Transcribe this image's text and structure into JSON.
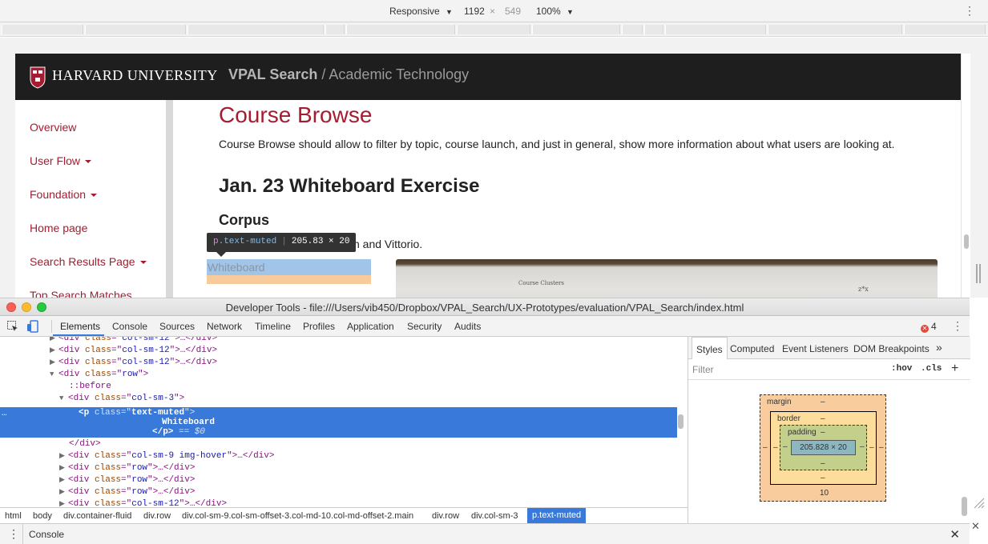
{
  "device_toolbar": {
    "mode": "Responsive",
    "width": "1192",
    "times": "×",
    "height": "549",
    "zoom": "100%",
    "more": "⋮"
  },
  "page": {
    "university": "HARVARD UNIVERSITY",
    "site_title": "VPAL Search",
    "site_subtitle": " / Academic Technology",
    "shield_text": "VE RI TAS",
    "nav": [
      {
        "label": "Overview",
        "dropdown": false
      },
      {
        "label": "User Flow",
        "dropdown": true
      },
      {
        "label": "Foundation",
        "dropdown": true
      },
      {
        "label": "Home page",
        "dropdown": false
      },
      {
        "label": "Search Results Page",
        "dropdown": true
      },
      {
        "label": "Top Search Matches",
        "dropdown": false
      }
    ],
    "heading": "Course Browse",
    "intro": "Course Browse should allow to filter by topic, course launch, and just in general, show more information about what users are looking at.",
    "exercise_heading": "Jan. 23 Whiteboard Exercise",
    "corpus_heading": "Corpus",
    "corpus_text_visible": "h and Vittorio.",
    "selected_text": "Whiteboard",
    "whiteboard_note_1": "Course\nClusters",
    "whiteboard_note_2": "z*x"
  },
  "tooltip": {
    "tag": "p",
    "cls": ".text-muted",
    "size": "205.83 × 20"
  },
  "devtools": {
    "title": "Developer Tools - file:///Users/vib450/Dropbox/VPAL_Search/UX-Prototypes/evaluation/VPAL_Search/index.html",
    "tabs": [
      "Elements",
      "Console",
      "Sources",
      "Network",
      "Timeline",
      "Profiles",
      "Application",
      "Security",
      "Audits"
    ],
    "active_tab": "Elements",
    "error_count": "4",
    "more": "⋮",
    "dom": {
      "l1": {
        "open": "<div ",
        "attr": "class",
        "eq": "=\"",
        "val": "col-sm-12",
        "close": "\">…</div>"
      },
      "l2": {
        "open": "<div ",
        "attr": "class",
        "eq": "=\"",
        "val": "col-sm-12",
        "close": "\">…</div>"
      },
      "l3": {
        "open": "<div ",
        "attr": "class",
        "eq": "=\"",
        "val": "col-sm-12",
        "close": "\">…</div>"
      },
      "l4": {
        "open": "<div ",
        "attr": "class",
        "eq": "=\"",
        "val": "row",
        "close": "\">"
      },
      "l5": "::before",
      "l6": {
        "open": "<div ",
        "attr": "class",
        "eq": "=\"",
        "val": "col-sm-3",
        "close": "\">"
      },
      "sel_open": "<p ",
      "sel_attr": "class",
      "sel_eq": "=\"",
      "sel_val": "text-muted",
      "sel_close": "\">",
      "sel_text": "Whiteboard",
      "sel_end": "</p>",
      "sel_marker": " == $0",
      "l8": "</div>",
      "l9": {
        "open": "<div ",
        "attr": "class",
        "eq": "=\"",
        "val": "col-sm-9 img-hover",
        "close": "\">…</div>"
      },
      "l10": {
        "open": "<div ",
        "attr": "class",
        "eq": "=\"",
        "val": "row",
        "close": "\">…</div>"
      },
      "l11": {
        "open": "<div ",
        "attr": "class",
        "eq": "=\"",
        "val": "row",
        "close": "\">…</div>"
      },
      "l12": {
        "open": "<div ",
        "attr": "class",
        "eq": "=\"",
        "val": "row",
        "close": "\">…</div>"
      },
      "l13": {
        "open": "<div ",
        "attr": "class",
        "eq": "=\"",
        "val": "col-sm-12",
        "close": "\">…</div>"
      }
    },
    "breadcrumbs": [
      "html",
      "body",
      "div.container-fluid",
      "div.row",
      "div.col-sm-9.col-sm-offset-3.col-md-10.col-md-offset-2.main",
      "div.row",
      "div.col-sm-3",
      "p.text-muted"
    ],
    "styles_tabs": [
      "Styles",
      "Computed",
      "Event Listeners",
      "DOM Breakpoints",
      "»"
    ],
    "filter_placeholder": "Filter",
    "hov": ":hov",
    "cls": ".cls",
    "plus": "+",
    "box_model": {
      "margin_label": "margin",
      "margin_top": "–",
      "margin_bottom": "10",
      "margin_left": "–",
      "margin_right": "–",
      "border_label": "border",
      "border_top": "–",
      "border_bottom": "–",
      "border_left": "–",
      "border_right": "–",
      "padding_label": "padding",
      "padding_top": "–",
      "padding_bottom": "–",
      "padding_left": "–",
      "padding_right": "–",
      "content": "205.828 × 20"
    },
    "drawer": "Console",
    "close": "✕"
  },
  "colors": {
    "harvard_crimson": "#a51c30",
    "selection_blue": "#3879d9",
    "margin": "#f9cc9d",
    "border": "#fddd9b",
    "padding": "#c3d08b",
    "content": "#8cb6c0"
  }
}
